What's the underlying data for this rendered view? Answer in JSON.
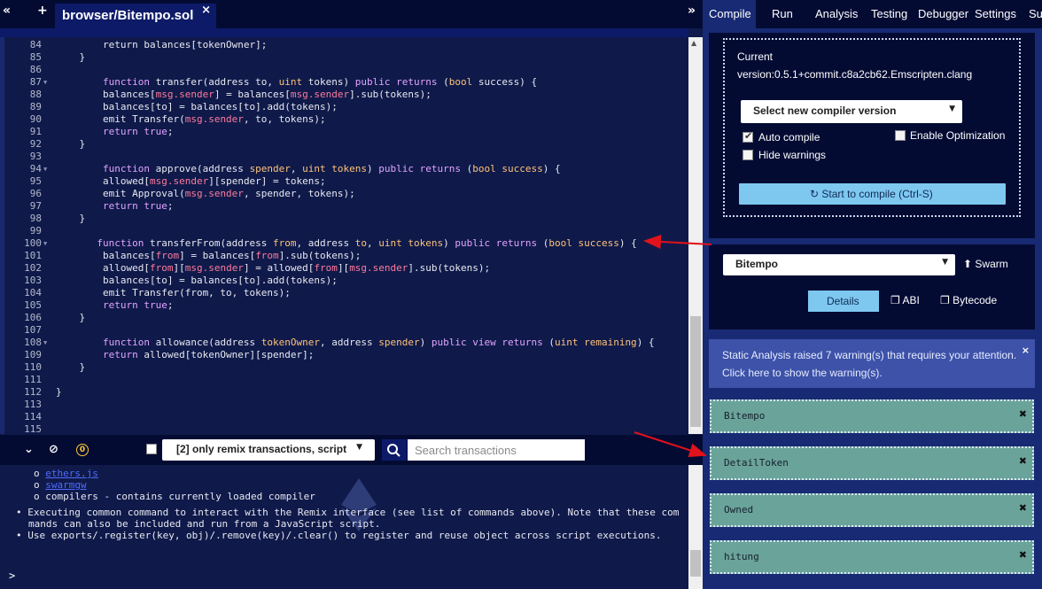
{
  "tabbar": {
    "left_icons": [
      "«",
      "+"
    ],
    "file_tab": "browser/Bitempo.sol",
    "close": "×",
    "expand": "»"
  },
  "editor": {
    "lines": [
      {
        "n": "84",
        "fold": false,
        "code": [
          [
            "",
            "        return balances[tokenOwner];"
          ]
        ]
      },
      {
        "n": "85",
        "fold": false,
        "code": [
          [
            "",
            "    }"
          ]
        ]
      },
      {
        "n": "86",
        "fold": false,
        "code": [
          [
            "",
            ""
          ]
        ]
      },
      {
        "n": "87",
        "fold": true,
        "code": [
          [
            "k",
            "        function "
          ],
          [
            "",
            "transfer(address to, "
          ],
          [
            "t",
            "uint"
          ],
          [
            "",
            " tokens) "
          ],
          [
            "k",
            "public returns "
          ],
          [
            "",
            "("
          ],
          [
            "t",
            "bool"
          ],
          [
            "",
            " success) {"
          ]
        ]
      },
      {
        "n": "88",
        "fold": false,
        "code": [
          [
            "",
            "        balances["
          ],
          [
            "v",
            "msg.sender"
          ],
          [
            "",
            "] = balances["
          ],
          [
            "v",
            "msg.sender"
          ],
          [
            "",
            "].sub(tokens);"
          ]
        ]
      },
      {
        "n": "89",
        "fold": false,
        "code": [
          [
            "",
            "        balances[to] = balances[to].add(tokens);"
          ]
        ]
      },
      {
        "n": "90",
        "fold": false,
        "code": [
          [
            "",
            "        emit Transfer("
          ],
          [
            "v",
            "msg.sender"
          ],
          [
            "",
            ", to, tokens);"
          ]
        ]
      },
      {
        "n": "91",
        "fold": false,
        "code": [
          [
            "k",
            "        return true"
          ],
          [
            "",
            ";"
          ]
        ]
      },
      {
        "n": "92",
        "fold": false,
        "code": [
          [
            "",
            "    }"
          ]
        ]
      },
      {
        "n": "93",
        "fold": false,
        "code": [
          [
            "",
            ""
          ]
        ]
      },
      {
        "n": "94",
        "fold": true,
        "code": [
          [
            "k",
            "        function "
          ],
          [
            "",
            "approve(address "
          ],
          [
            "t",
            "spender"
          ],
          [
            "",
            ", "
          ],
          [
            "t",
            "uint tokens"
          ],
          [
            "",
            ") "
          ],
          [
            "k",
            "public returns "
          ],
          [
            "",
            "("
          ],
          [
            "t",
            "bool"
          ],
          [
            "",
            " "
          ],
          [
            "t",
            "success"
          ],
          [
            "",
            ") {"
          ]
        ]
      },
      {
        "n": "95",
        "fold": false,
        "code": [
          [
            "",
            "        allowed["
          ],
          [
            "v",
            "msg.sender"
          ],
          [
            "",
            "][spender] = tokens;"
          ]
        ]
      },
      {
        "n": "96",
        "fold": false,
        "code": [
          [
            "",
            "        emit Approval("
          ],
          [
            "v",
            "msg.sender"
          ],
          [
            "",
            ", spender, tokens);"
          ]
        ]
      },
      {
        "n": "97",
        "fold": false,
        "code": [
          [
            "k",
            "        return true"
          ],
          [
            "",
            ";"
          ]
        ]
      },
      {
        "n": "98",
        "fold": false,
        "code": [
          [
            "",
            "    }"
          ]
        ]
      },
      {
        "n": "99",
        "fold": false,
        "code": [
          [
            "",
            ""
          ]
        ]
      },
      {
        "n": "100",
        "fold": true,
        "code": [
          [
            "k",
            "       function "
          ],
          [
            "",
            "transferFrom(address "
          ],
          [
            "t",
            "from"
          ],
          [
            "",
            ", address "
          ],
          [
            "t",
            "to"
          ],
          [
            "",
            ", "
          ],
          [
            "t",
            "uint tokens"
          ],
          [
            "",
            ") "
          ],
          [
            "k",
            "public returns "
          ],
          [
            "",
            "("
          ],
          [
            "t",
            "bool"
          ],
          [
            "",
            " "
          ],
          [
            "t",
            "success"
          ],
          [
            "",
            ") {"
          ]
        ]
      },
      {
        "n": "101",
        "fold": false,
        "code": [
          [
            "",
            "        balances["
          ],
          [
            "v",
            "from"
          ],
          [
            "",
            "] = balances["
          ],
          [
            "v",
            "from"
          ],
          [
            "",
            "].sub(tokens);"
          ]
        ]
      },
      {
        "n": "102",
        "fold": false,
        "code": [
          [
            "",
            "        allowed["
          ],
          [
            "v",
            "from"
          ],
          [
            "",
            "]["
          ],
          [
            "v",
            "msg.sender"
          ],
          [
            "",
            "] = allowed["
          ],
          [
            "v",
            "from"
          ],
          [
            "",
            "]["
          ],
          [
            "v",
            "msg.sender"
          ],
          [
            "",
            "].sub(tokens);"
          ]
        ]
      },
      {
        "n": "103",
        "fold": false,
        "code": [
          [
            "",
            "        balances[to] = balances[to].add(tokens);"
          ]
        ]
      },
      {
        "n": "104",
        "fold": false,
        "code": [
          [
            "",
            "        emit Transfer(from, to, tokens);"
          ]
        ]
      },
      {
        "n": "105",
        "fold": false,
        "code": [
          [
            "k",
            "        return true"
          ],
          [
            "",
            ";"
          ]
        ]
      },
      {
        "n": "106",
        "fold": false,
        "code": [
          [
            "",
            "    }"
          ]
        ]
      },
      {
        "n": "107",
        "fold": false,
        "code": [
          [
            "",
            ""
          ]
        ]
      },
      {
        "n": "108",
        "fold": true,
        "code": [
          [
            "k",
            "        function "
          ],
          [
            "",
            "allowance(address "
          ],
          [
            "t",
            "tokenOwner"
          ],
          [
            "",
            ", address "
          ],
          [
            "t",
            "spender"
          ],
          [
            "",
            ") "
          ],
          [
            "k",
            "public view returns "
          ],
          [
            "",
            "("
          ],
          [
            "t",
            "uint remaining"
          ],
          [
            "",
            ") {"
          ]
        ]
      },
      {
        "n": "109",
        "fold": false,
        "code": [
          [
            "k",
            "        return "
          ],
          [
            "",
            "allowed[tokenOwner][spender];"
          ]
        ]
      },
      {
        "n": "110",
        "fold": false,
        "code": [
          [
            "",
            "    }"
          ]
        ]
      },
      {
        "n": "111",
        "fold": false,
        "code": [
          [
            "",
            ""
          ]
        ]
      },
      {
        "n": "112",
        "fold": false,
        "code": [
          [
            "",
            "}"
          ]
        ]
      },
      {
        "n": "113",
        "fold": false,
        "code": [
          [
            "",
            ""
          ]
        ]
      },
      {
        "n": "114",
        "fold": false,
        "code": [
          [
            "",
            ""
          ]
        ]
      },
      {
        "n": "115",
        "fold": false,
        "code": [
          [
            "",
            ""
          ]
        ]
      }
    ]
  },
  "terminal_bar": {
    "collapse_icon": "»",
    "clear_icon": "⊘",
    "pending": "0",
    "filter_label": "[2] only remix transactions, script",
    "search_placeholder": "Search transactions"
  },
  "terminal": {
    "lines": [
      {
        "kind": "link",
        "bullet": "o",
        "text": "ethers.js"
      },
      {
        "kind": "link",
        "bullet": "o",
        "text": "swarmgw"
      },
      {
        "kind": "text",
        "bullet": "o",
        "text": "compilers - contains currently loaded compiler"
      },
      {
        "kind": "text",
        "bullet": "•",
        "text": "Executing common command to interact with the Remix interface (see list of commands above). Note that these com"
      },
      {
        "kind": "text",
        "bullet": "",
        "text": "mands can also be included and run from a JavaScript script."
      },
      {
        "kind": "text",
        "bullet": "•",
        "text": "Use exports/.register(key, obj)/.remove(key)/.clear() to register and reuse object across script executions."
      }
    ],
    "prompt": ">"
  },
  "right_nav": {
    "tabs": [
      "Compile",
      "Run",
      "Analysis",
      "Testing",
      "Debugger",
      "Settings",
      "Su"
    ]
  },
  "compile": {
    "current_label": "Current",
    "version": "version:0.5.1+commit.c8a2cb62.Emscripten.clang",
    "select_label": "Select new compiler version",
    "auto_compile": "Auto compile",
    "enable_optimization": "Enable Optimization",
    "hide_warnings": "Hide warnings",
    "compile_button": "Start to compile (Ctrl-S)"
  },
  "contract": {
    "selected": "Bitempo",
    "swarm": "Swarm",
    "details": "Details",
    "abi": "ABI",
    "bytecode": "Bytecode"
  },
  "warning": {
    "line1": "Static Analysis raised 7 warning(s) that requires your attention.",
    "line2": "Click here to show the warning(s).",
    "close": "×"
  },
  "warning_cards": [
    {
      "label": "Bitempo"
    },
    {
      "label": "DetailToken"
    },
    {
      "label": "Owned"
    },
    {
      "label": "hitung"
    }
  ],
  "colors": {
    "annotation_arrow": "#e0121b",
    "compile_button": "#7ec8f0",
    "warning_card": "#6aa39a"
  }
}
